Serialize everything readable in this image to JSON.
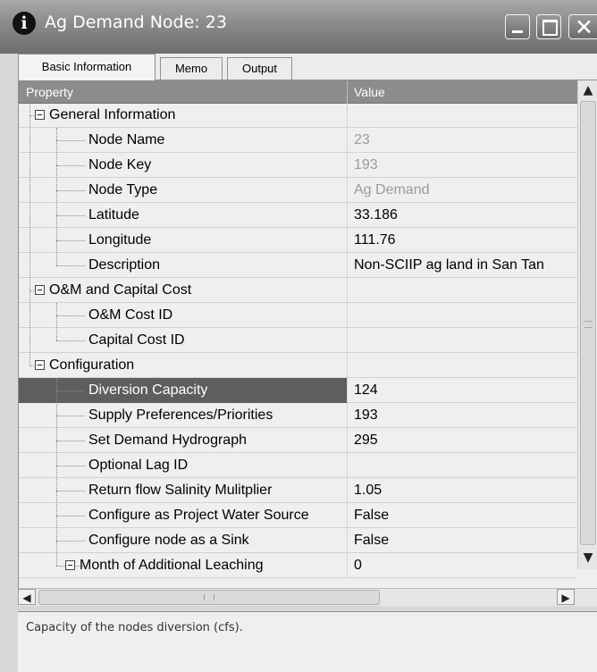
{
  "window": {
    "title": "Ag Demand Node:  23",
    "info_icon": "info-icon",
    "close_glyph": "✕"
  },
  "tabs": [
    {
      "label": "Basic Information",
      "active": true
    },
    {
      "label": "Memo",
      "active": false
    },
    {
      "label": "Output",
      "active": false
    }
  ],
  "grid": {
    "header": {
      "property": "Property",
      "value": "Value"
    },
    "rows": [
      {
        "label": "General Information",
        "value": "",
        "category": true
      },
      {
        "label": "Node Name",
        "value": "23",
        "readonly": true
      },
      {
        "label": "Node Key",
        "value": "193",
        "readonly": true
      },
      {
        "label": "Node Type",
        "value": "Ag Demand",
        "readonly": true
      },
      {
        "label": "Latitude",
        "value": "33.186"
      },
      {
        "label": "Longitude",
        "value": "111.76"
      },
      {
        "label": "Description",
        "value": "Non-SCIIP ag land in San Tan"
      },
      {
        "label": "O&M and Capital Cost",
        "value": "",
        "category": true
      },
      {
        "label": "O&M Cost ID",
        "value": ""
      },
      {
        "label": "Capital Cost ID",
        "value": ""
      },
      {
        "label": "Configuration",
        "value": "",
        "category": true
      },
      {
        "label": "Diversion Capacity",
        "value": "124",
        "selected": true
      },
      {
        "label": "Supply Preferences/Priorities",
        "value": "193"
      },
      {
        "label": "Set Demand Hydrograph",
        "value": "295"
      },
      {
        "label": "Optional Lag ID",
        "value": ""
      },
      {
        "label": "Return flow Salinity Mulitplier",
        "value": "1.05"
      },
      {
        "label": "Configure as Project Water Source",
        "value": "False"
      },
      {
        "label": "Configure node as a Sink",
        "value": "False"
      },
      {
        "label": "Month of Additional Leaching",
        "value": "0",
        "expander": true
      }
    ]
  },
  "scrollbars": {
    "up": "▲",
    "down": "▼",
    "left": "◀",
    "right": "▶"
  },
  "description_text": "Capacity of the nodes diversion (cfs)."
}
